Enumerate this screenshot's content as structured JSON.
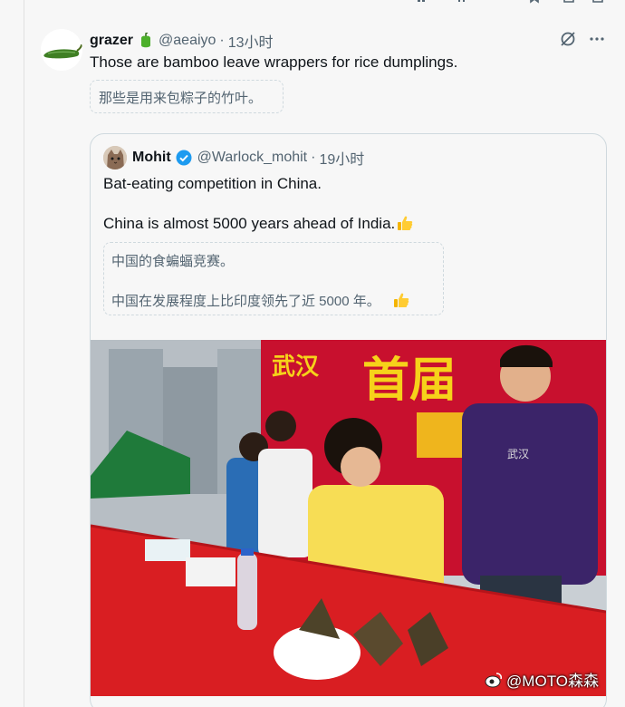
{
  "reply": {
    "name": "grazer",
    "handle": "@aeaiyo",
    "separator": "·",
    "time": "13小时",
    "text": "Those are bamboo leave wrappers for rice dumplings.",
    "translation": "那些是用来包粽子的竹叶。",
    "badge_icon": "green-pepper-icon",
    "avatar_icon": "jalapeno-icon"
  },
  "quoted": {
    "name": "Mohit",
    "handle": "@Warlock_mohit",
    "separator": "·",
    "time": "19小时",
    "line1": "Bat-eating competition in China.",
    "line2": "China is almost 5000 years ahead of India.",
    "translation_line1": "中国的食蝙蝠竞赛。",
    "translation_line2": "中国在发展程度上比印度领先了近 5000 年。",
    "emoji": "thumbs-up-icon"
  },
  "photo": {
    "banner_text": "首届",
    "banner_text_2": "武汉",
    "shirt_text": "武汉"
  },
  "watermark": "@MOTO森森",
  "colors": {
    "accent": "#1d9bf0",
    "text": "#0f1419",
    "muted": "#536471",
    "banner_red": "#c8102e",
    "banner_yellow": "#f6d21a"
  }
}
